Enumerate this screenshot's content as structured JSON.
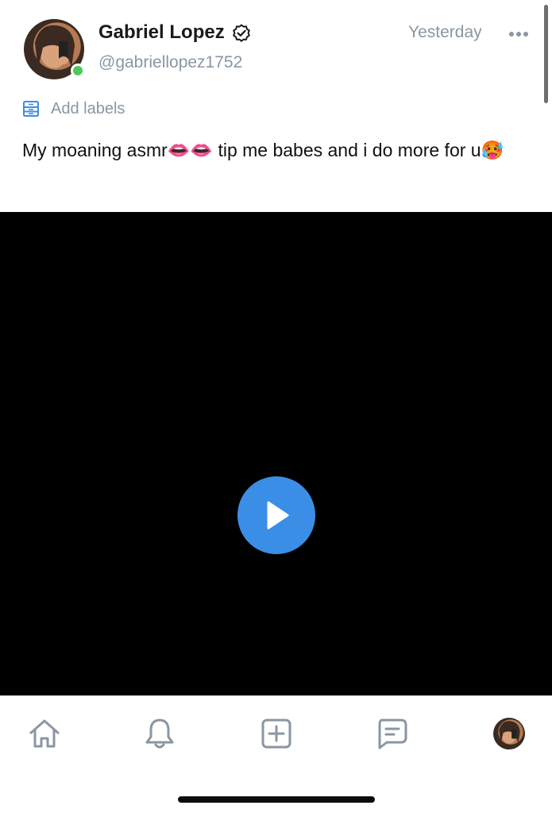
{
  "post": {
    "author_name": "Gabriel Lopez",
    "author_handle": "@gabriellopez1752",
    "timestamp": "Yesterday",
    "labels_action": "Add labels",
    "text": "My moaning asmr👄👄 tip me babes and i do more for u🥵",
    "online": true,
    "verified": true
  },
  "video": {
    "play_icon": "play-icon"
  },
  "bottom_nav": {
    "items": [
      "home-icon",
      "bell-icon",
      "add-post-icon",
      "messages-icon",
      "profile-avatar"
    ]
  },
  "colors": {
    "accent": "#3b8ee6",
    "online": "#4cc95a",
    "muted_text": "#8a96a3",
    "icon_gray": "#8a96a3"
  }
}
